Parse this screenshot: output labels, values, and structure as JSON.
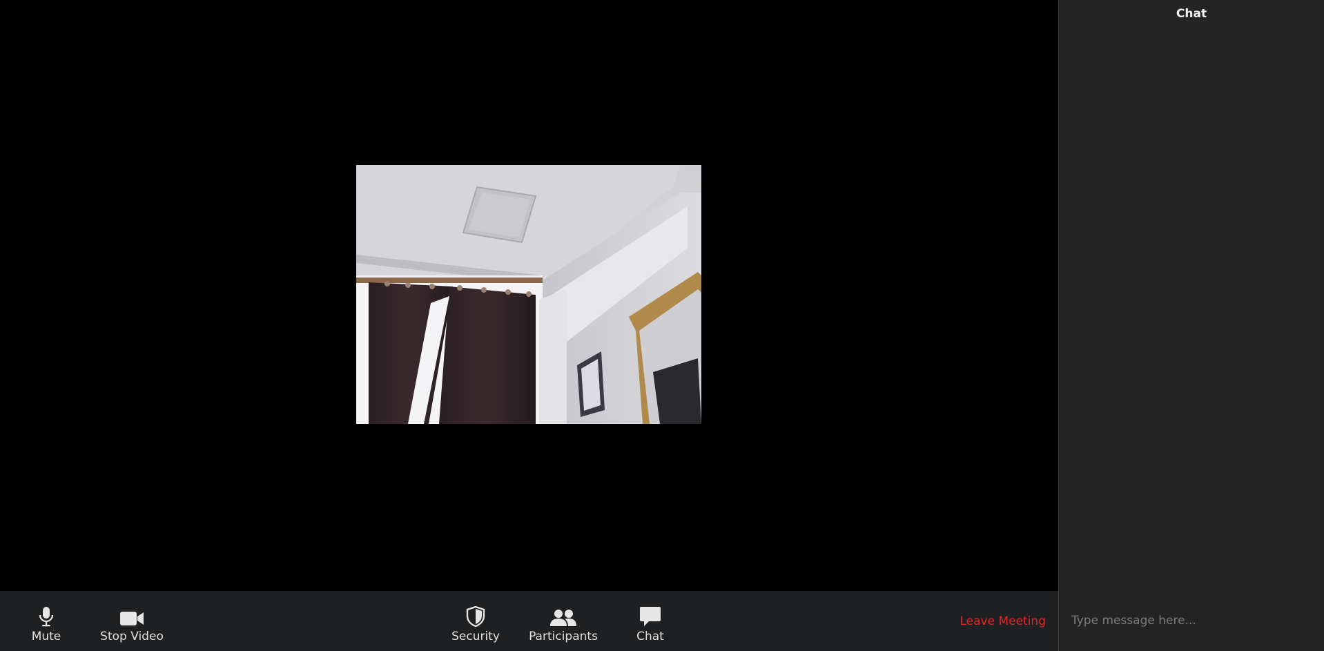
{
  "chat_panel": {
    "title": "Chat",
    "input_placeholder": "Type message here..."
  },
  "toolbar": {
    "mute_label": "Mute",
    "stop_video_label": "Stop Video",
    "security_label": "Security",
    "participants_label": "Participants",
    "chat_label": "Chat",
    "leave_label": "Leave Meeting"
  },
  "icons": {
    "mute": "microphone-icon",
    "stop_video": "video-camera-icon",
    "security": "shield-icon",
    "participants": "participants-icon",
    "chat": "chat-bubble-icon"
  },
  "colors": {
    "toolbar_bg": "#1f2022",
    "chat_panel_bg": "#242424",
    "leave_text": "#e02828",
    "icon": "#e6e6e6"
  }
}
